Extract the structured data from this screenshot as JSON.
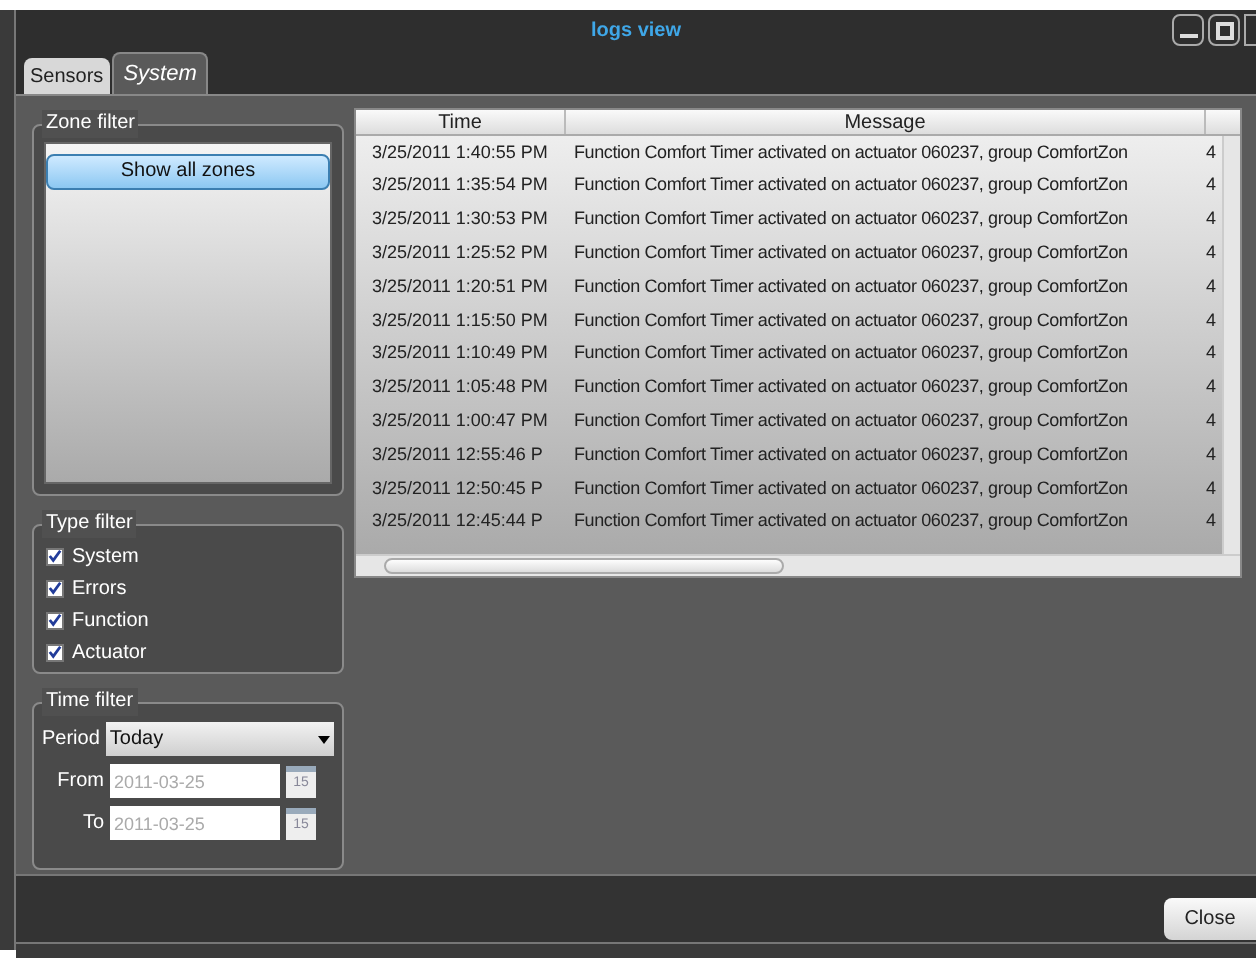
{
  "window": {
    "title": "logs view"
  },
  "tabs": [
    {
      "label": "Sensors",
      "selected": false
    },
    {
      "label": "System",
      "selected": true
    }
  ],
  "zone_filter": {
    "title": "Zone filter",
    "button": "Show all zones"
  },
  "type_filter": {
    "title": "Type filter",
    "items": [
      {
        "label": "System",
        "checked": true
      },
      {
        "label": "Errors",
        "checked": true
      },
      {
        "label": "Function",
        "checked": true
      },
      {
        "label": "Actuator",
        "checked": true
      }
    ]
  },
  "time_filter": {
    "title": "Time filter",
    "period_label": "Period",
    "period_value": "Today",
    "from_label": "From",
    "from_value": "2011-03-25",
    "from_calendar_day": "15",
    "to_label": "To",
    "to_value": "2011-03-25",
    "to_calendar_day": "15"
  },
  "table": {
    "columns": [
      "Time",
      "Message"
    ],
    "rows": [
      [
        "3/25/2011 1:40:55 PM",
        "Function Comfort Timer activated on actuator 060237, group ComfortZon",
        "4"
      ],
      [
        "3/25/2011 1:35:54 PM",
        "Function Comfort Timer activated on actuator 060237, group ComfortZon",
        "4"
      ],
      [
        "3/25/2011 1:30:53 PM",
        "Function Comfort Timer activated on actuator 060237, group ComfortZon",
        "4"
      ],
      [
        "3/25/2011 1:25:52 PM",
        "Function Comfort Timer activated on actuator 060237, group ComfortZon",
        "4"
      ],
      [
        "3/25/2011 1:20:51 PM",
        "Function Comfort Timer activated on actuator 060237, group ComfortZon",
        "4"
      ],
      [
        "3/25/2011 1:15:50 PM",
        "Function Comfort Timer activated on actuator 060237, group ComfortZon",
        "4"
      ],
      [
        "3/25/2011 1:10:49 PM",
        "Function Comfort Timer activated on actuator 060237, group ComfortZon",
        "4"
      ],
      [
        "3/25/2011 1:05:48 PM",
        "Function Comfort Timer activated on actuator 060237, group ComfortZon",
        "4"
      ],
      [
        "3/25/2011 1:00:47 PM",
        "Function Comfort Timer activated on actuator 060237, group ComfortZon",
        "4"
      ],
      [
        "3/25/2011 12:55:46 P",
        "Function Comfort Timer activated on actuator 060237, group ComfortZon",
        "4"
      ],
      [
        "3/25/2011 12:50:45 P",
        "Function Comfort Timer activated on actuator 060237, group ComfortZon",
        "4"
      ],
      [
        "3/25/2011 12:45:44 P",
        "Function Comfort Timer activated on actuator 060237, group ComfortZon",
        "4"
      ]
    ]
  },
  "footer": {
    "close_button": "Close"
  }
}
